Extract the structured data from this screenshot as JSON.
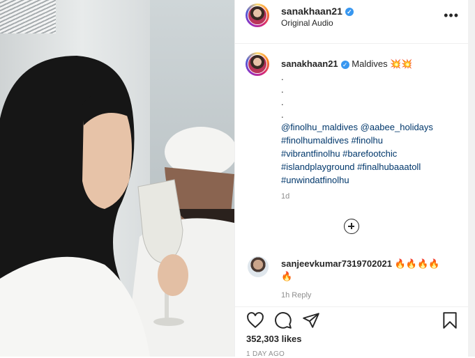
{
  "post": {
    "username": "sanakhaan21",
    "audio": "Original Audio",
    "more_label": "•••"
  },
  "caption": {
    "username": "sanakhaan21",
    "text": "Maldives",
    "emoji": "💥💥",
    "dots": [
      ".",
      ".",
      ".",
      "."
    ],
    "tags": [
      "@finolhu_maldives @aabee_holidays",
      "#finolhumaldives #finolhu",
      "#vibrantfinolhu #barefootchic",
      "#islandplayground #finalhubaaatoll",
      "#unwindatfinolhu"
    ],
    "time": "1d"
  },
  "comment": {
    "username": "sanjeevkumar7319702021",
    "text": "🔥🔥🔥🔥",
    "text2": "🔥",
    "meta": "1h   Reply"
  },
  "actions": {
    "likes": "352,303 likes",
    "age": "1 DAY AGO"
  },
  "icons": [
    "heart-icon",
    "comment-icon",
    "share-icon",
    "bookmark-icon",
    "more-icon",
    "verified-badge-icon",
    "plus-icon"
  ],
  "colors": {
    "link": "#00376b",
    "verified": "#3897f0",
    "muted": "#8e8e8e"
  }
}
